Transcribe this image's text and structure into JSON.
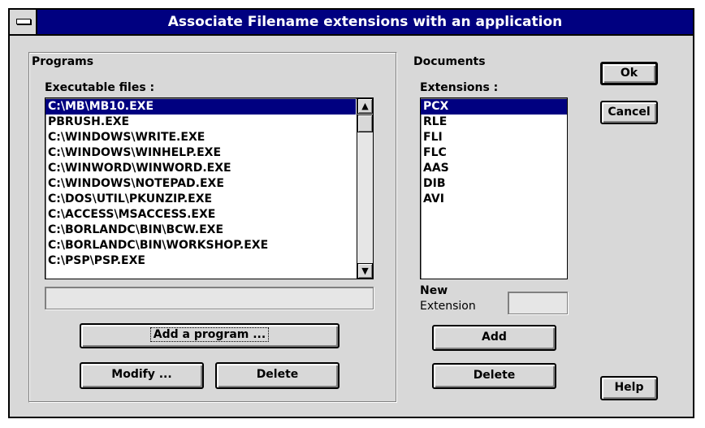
{
  "window": {
    "title": "Associate Filename extensions with an application"
  },
  "programs": {
    "group_label": "Programs",
    "list_label": "Executable files :",
    "files": [
      "C:\\MB\\MB10.EXE",
      "PBRUSH.EXE",
      "C:\\WINDOWS\\WRITE.EXE",
      "C:\\WINDOWS\\WINHELP.EXE",
      "C:\\WINWORD\\WINWORD.EXE",
      "C:\\WINDOWS\\NOTEPAD.EXE",
      "C:\\DOS\\UTIL\\PKUNZIP.EXE",
      "C:\\ACCESS\\MSACCESS.EXE",
      "C:\\BORLANDC\\BIN\\BCW.EXE",
      "C:\\BORLANDC\\BIN\\WORKSHOP.EXE",
      "C:\\PSP\\PSP.EXE"
    ],
    "selected_index": 0,
    "path_value": "",
    "add_label": "Add a program ...",
    "modify_label": "Modify ...",
    "delete_label": "Delete"
  },
  "documents": {
    "group_label": "Documents",
    "list_label": "Extensions :",
    "extensions": [
      "PCX",
      "RLE",
      "FLI",
      "FLC",
      "AAS",
      "DIB",
      "AVI"
    ],
    "selected_index": 0,
    "new_label_1": "New",
    "new_label_2": "Extension",
    "new_value": "",
    "add_label": "Add",
    "delete_label": "Delete"
  },
  "buttons": {
    "ok": "Ok",
    "cancel": "Cancel",
    "help": "Help"
  },
  "icons": {
    "system_menu": "system-menu-icon",
    "scroll_up": "arrow-up-icon",
    "scroll_down": "arrow-down-icon"
  },
  "colors": {
    "titlebar": "#000080",
    "selection": "#000080",
    "face": "#d8d8d8"
  }
}
